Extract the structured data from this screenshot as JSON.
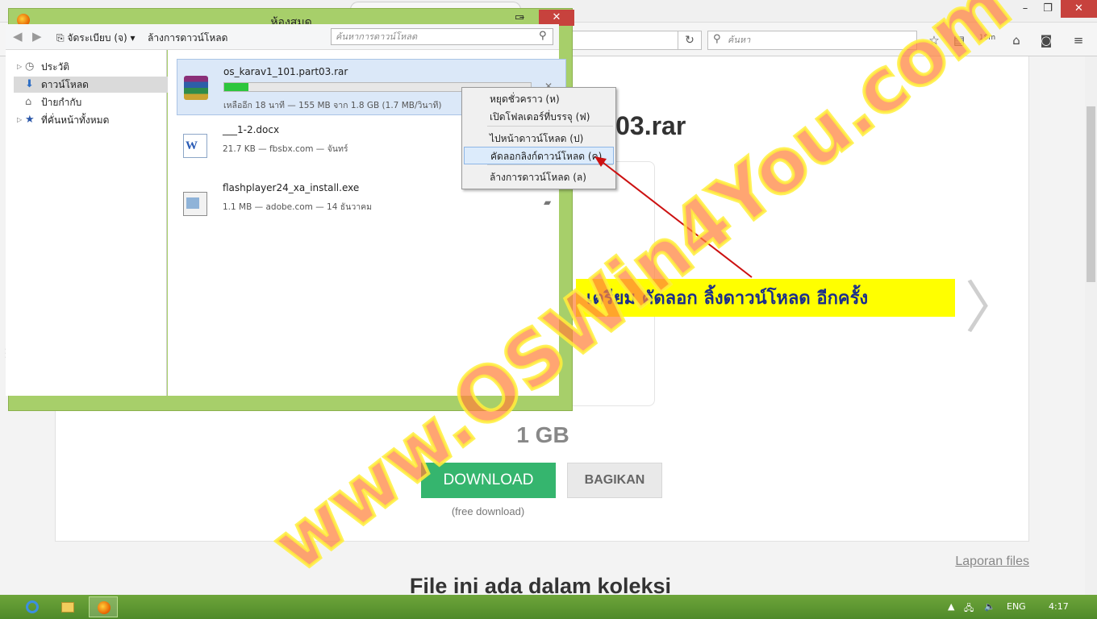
{
  "browser": {
    "search_placeholder": "ค้นหา",
    "downloads_badge": "18m",
    "icons": [
      "star-icon",
      "reading-list-icon",
      "downloads-icon",
      "home-icon",
      "pocket-icon",
      "menu-icon"
    ]
  },
  "page": {
    "filename_fragment": "rt03.rar",
    "file_size": "1 GB",
    "download_label": "DOWNLOAD",
    "share_label": "BAGIKAN",
    "free_download": "(free download)",
    "report_link": "Laporan files",
    "collection_heading": "File ini ada dalam koleksi"
  },
  "library": {
    "title": "ห้องสมุด",
    "toolbar": {
      "organize_label": "จัดระเบียบ (จ)",
      "clear_label": "ล้างการดาวน์โหลด",
      "search_placeholder": "ค้นหาการดาวน์โหลด"
    },
    "sidebar": [
      {
        "label": "ประวัติ",
        "icon": "clock-icon",
        "twisty": true,
        "selected": false
      },
      {
        "label": "ดาวน์โหลด",
        "icon": "download-arrow-icon",
        "twisty": false,
        "selected": true
      },
      {
        "label": "ป้ายกำกับ",
        "icon": "tag-icon",
        "twisty": false,
        "selected": false
      },
      {
        "label": "ที่คั่นหน้าทั้งหมด",
        "icon": "bookmark-star-icon",
        "twisty": true,
        "selected": false
      }
    ],
    "downloads": [
      {
        "name": "os_karav1_101.part03.rar",
        "status": "เหลืออีก 18 นาที — 155 MB จาก 1.8 GB (1.7 MB/วินาที)",
        "progress": 0.08,
        "type": "rar"
      },
      {
        "name": "___1-2.docx",
        "status": "21.7 KB — fbsbx.com — จันทร์",
        "type": "docx"
      },
      {
        "name": "flashplayer24_xa_install.exe",
        "status": "1.1 MB — adobe.com — 14 ธันวาคม",
        "type": "exe"
      }
    ]
  },
  "context_menu": {
    "items": [
      {
        "label": "หยุดชั่วคราว (ห)",
        "highlight": false
      },
      {
        "label": "เปิดโฟลเดอร์ที่บรรจุ (ฟ)",
        "highlight": false
      },
      {
        "label": "ไปหน้าดาวน์โหลด (ป)",
        "highlight": false
      },
      {
        "label": "คัดลอกลิงก์ดาวน์โหลด (ค)",
        "highlight": true
      },
      {
        "label": "ล้างการดาวน์โหลด (ล)",
        "highlight": false
      }
    ]
  },
  "annotation": {
    "text": "เตรียม คัดลอก ลิ้งดาวน์โหลด อีกครั้ง",
    "bg_color": "#ffff00",
    "text_color": "#1a2d8c",
    "arrow_color": "#cc1111"
  },
  "watermark": "www.OSWin4You.com",
  "taskbar": {
    "language": "ENG",
    "time": "4:17"
  },
  "colors": {
    "accent_green": "#35b56e",
    "window_frame": "#a7cf6a",
    "close_red": "#c7423d",
    "progress_green": "#2cc63d"
  }
}
